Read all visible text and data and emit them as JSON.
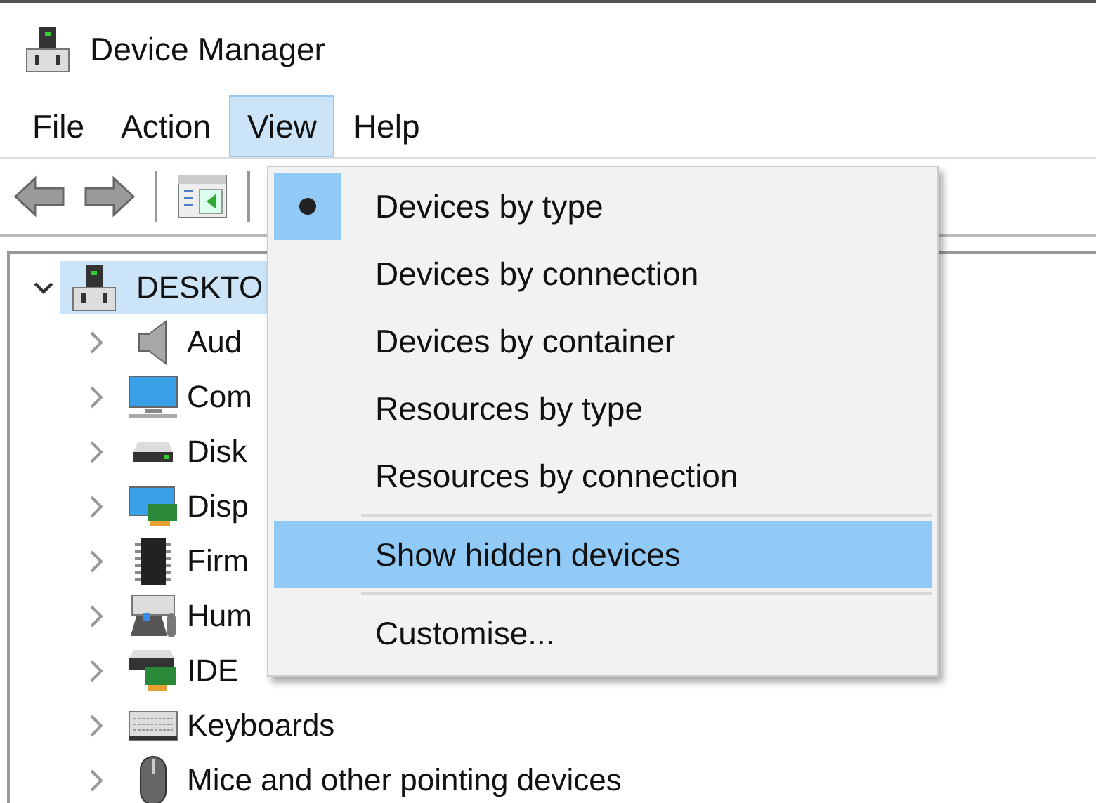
{
  "window": {
    "title": "Device Manager"
  },
  "menu_bar": [
    {
      "label": "File",
      "selected": false
    },
    {
      "label": "Action",
      "selected": false
    },
    {
      "label": "View",
      "selected": true
    },
    {
      "label": "Help",
      "selected": false
    }
  ],
  "tree": {
    "label": "DESKTO",
    "expanded": true,
    "selected": true,
    "children": [
      {
        "label": "Aud",
        "expanded": false
      },
      {
        "label": "Com",
        "expanded": false
      },
      {
        "label": "Disk",
        "expanded": false
      },
      {
        "label": "Disp",
        "expanded": false
      },
      {
        "label": "Firm",
        "expanded": false
      },
      {
        "label": "Hum",
        "expanded": false
      },
      {
        "label": "IDE",
        "expanded": false
      },
      {
        "label": "Keyboards",
        "expanded": false
      },
      {
        "label": "Mice and other pointing devices",
        "expanded": false
      }
    ]
  },
  "view_menu": [
    {
      "kind": "radio",
      "label": "Devices by type",
      "checked": true,
      "highlighted": false
    },
    {
      "kind": "radio",
      "label": "Devices by connection",
      "checked": false,
      "highlighted": false
    },
    {
      "kind": "radio",
      "label": "Devices by container",
      "checked": false,
      "highlighted": false
    },
    {
      "kind": "radio",
      "label": "Resources by type",
      "checked": false,
      "highlighted": false
    },
    {
      "kind": "radio",
      "label": "Resources by connection",
      "checked": false,
      "highlighted": false
    },
    {
      "kind": "separator"
    },
    {
      "kind": "command",
      "label": "Show hidden devices",
      "highlighted": true
    },
    {
      "kind": "separator"
    },
    {
      "kind": "command",
      "label": "Customise...",
      "highlighted": false
    }
  ]
}
